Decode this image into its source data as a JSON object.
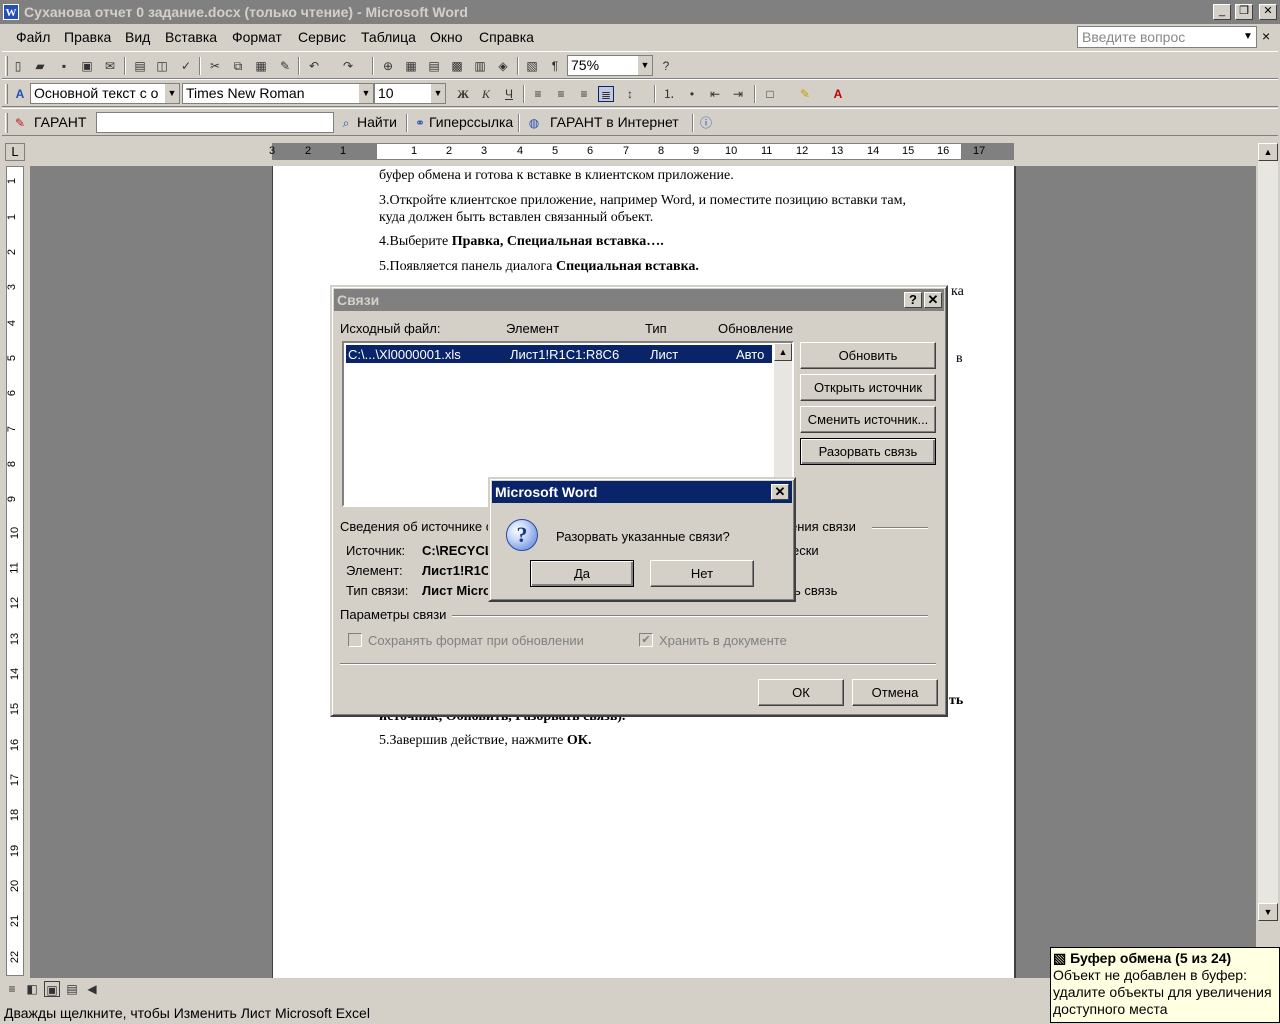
{
  "window": {
    "title": "Суханова отчет 0 задание.docx (только чтение) - Microsoft Word",
    "icon_letter": "W",
    "min": "_",
    "restore": "❐",
    "close": "✕"
  },
  "menu": {
    "items": [
      "Файл",
      "Правка",
      "Вид",
      "Вставка",
      "Формат",
      "Сервис",
      "Таблица",
      "Окно",
      "Справка"
    ],
    "ask_placeholder": "Введите вопрос",
    "ask_dropdown": "▼",
    "doc_close": "×"
  },
  "toolbar1": {
    "zoom": "75%"
  },
  "toolbar2": {
    "style": "Основной текст с о",
    "font": "Times New Roman",
    "size": "10"
  },
  "toolbar3": {
    "garant": "ГАРАНТ",
    "find": "Найти",
    "hyperlink": "Гиперссылка",
    "garant_internet": "ГАРАНТ в Интернет"
  },
  "ruler": {
    "numbers": [
      "3",
      "2",
      "1",
      "1",
      "2",
      "3",
      "4",
      "5",
      "6",
      "7",
      "8",
      "9",
      "10",
      "11",
      "12",
      "13",
      "14",
      "15",
      "16",
      "17"
    ],
    "tab_selector": "L"
  },
  "vruler": {
    "numbers": [
      "1",
      "1",
      "2",
      "3",
      "4",
      "5",
      "6",
      "7",
      "8",
      "9",
      "10",
      "11",
      "12",
      "13",
      "14",
      "15",
      "16",
      "17",
      "18",
      "19",
      "20",
      "21",
      "22",
      "23"
    ]
  },
  "document": {
    "p1": "буфер обмена и готова к вставке в клиентском приложение.",
    "p2a": "3.Откройте клиентское приложение, например Word, и поместите позицию вставки там,",
    "p2b": "куда должен быть вставлен связанный объект.",
    "p3_pre": "4.Выберите ",
    "p3_bold": "Правка, Специальная вставка….",
    "p4_pre": "5.Появляется панель диалога ",
    "p4_bold": "Специальная вставка.",
    "frag1": "ка",
    "frag2": "в",
    "frag3": "ть",
    "p5": "источник, Обновить, Разорвать связь).",
    "p6_pre": "5.Завершив действие, нажмите ",
    "p6_bold": "ОК."
  },
  "links_dialog": {
    "title": "Связи",
    "help": "?",
    "close": "✕",
    "columns": [
      "Исходный файл:",
      "Элемент",
      "Тип",
      "Обновление"
    ],
    "row": {
      "file": "C:\\...\\Xl0000001.xls",
      "item": "Лист1!R1C1:R8C6",
      "type": "Лист",
      "update": "Авто"
    },
    "buttons": [
      "Обновить",
      "Открыть источник",
      "Сменить источник...",
      "Разорвать связь"
    ],
    "source_info_label": "Сведения об источнике с",
    "update_method_label": "ения связи",
    "source_label": "Источник:",
    "source_value": "C:\\RECYCL",
    "element_label": "Элемент:",
    "element_value": "Лист1!R1C",
    "type_label": "Тип связи:",
    "type_value": "Лист Micro",
    "auto_frag": "ески",
    "lock_frag": "ть связь",
    "params_label": "Параметры связи",
    "keep_format": "Сохранять формат при обновлении",
    "store_in_doc": "Хранить в документе",
    "ok": "ОК",
    "cancel": "Отмена"
  },
  "msgbox": {
    "title": "Microsoft Word",
    "close": "✕",
    "text": "Разорвать указанные связи?",
    "yes": "Да",
    "no": "Нет"
  },
  "status": {
    "text": "Дважды щелкните, чтобы Изменить Лист Microsoft Excel"
  },
  "clipboard": {
    "title": "Буфер обмена (5 из 24)",
    "line1": "Объект не добавлен в буфер:",
    "line2": "удалите объекты для увеличения",
    "line3": "доступного места"
  }
}
